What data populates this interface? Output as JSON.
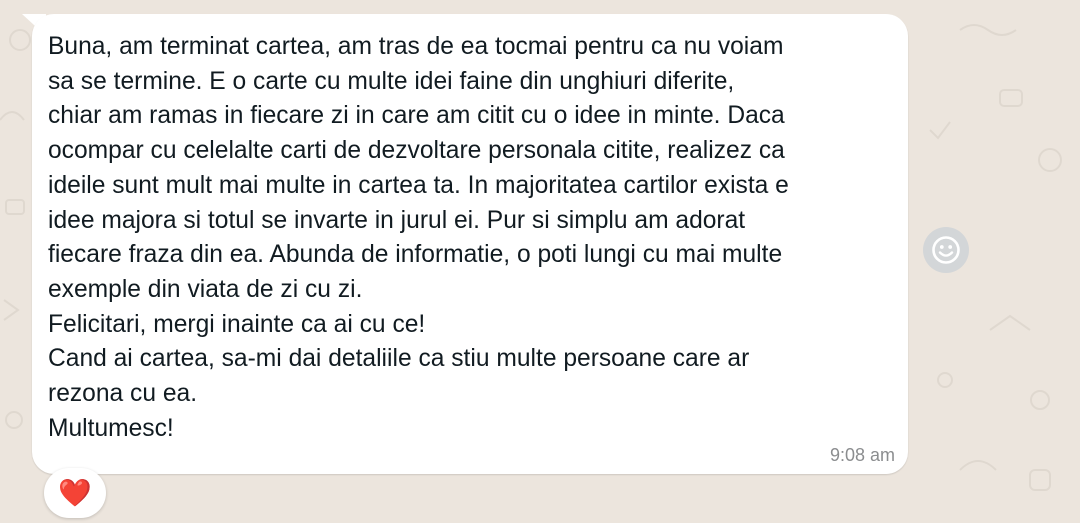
{
  "message": {
    "text": "Buna, am terminat cartea, am tras de ea tocmai pentru ca nu voiam\nsa se termine. E o carte cu multe idei faine din unghiuri diferite,\nchiar am ramas in fiecare zi in care am citit cu o idee in minte. Daca\nocompar cu celelalte carti de dezvoltare personala citite, realizez ca\nideile sunt mult mai multe in cartea ta. In majoritatea cartilor exista e\nidee majora si totul se invarte in jurul ei. Pur si simplu am adorat\nfiecare fraza din ea. Abunda de informatie, o poti lungi cu mai multe\nexemple din viata de zi cu zi.\nFelicitari, mergi inainte ca ai cu ce!\nCand ai cartea, sa-mi dai detaliile ca stiu multe persoane care ar\nrezona cu ea.\nMultumesc!",
    "time": "9:08 am"
  },
  "reaction": {
    "emoji": "❤️",
    "icon": "heart-icon"
  },
  "react_button": {
    "icon": "smiley-icon"
  },
  "colors": {
    "wallpaper": "#ece5dd",
    "bubble": "#ffffff",
    "text": "#111b21",
    "timestamp": "#8b8d8f",
    "react_button": "#d3d6d8",
    "heart": "#e0262a"
  }
}
